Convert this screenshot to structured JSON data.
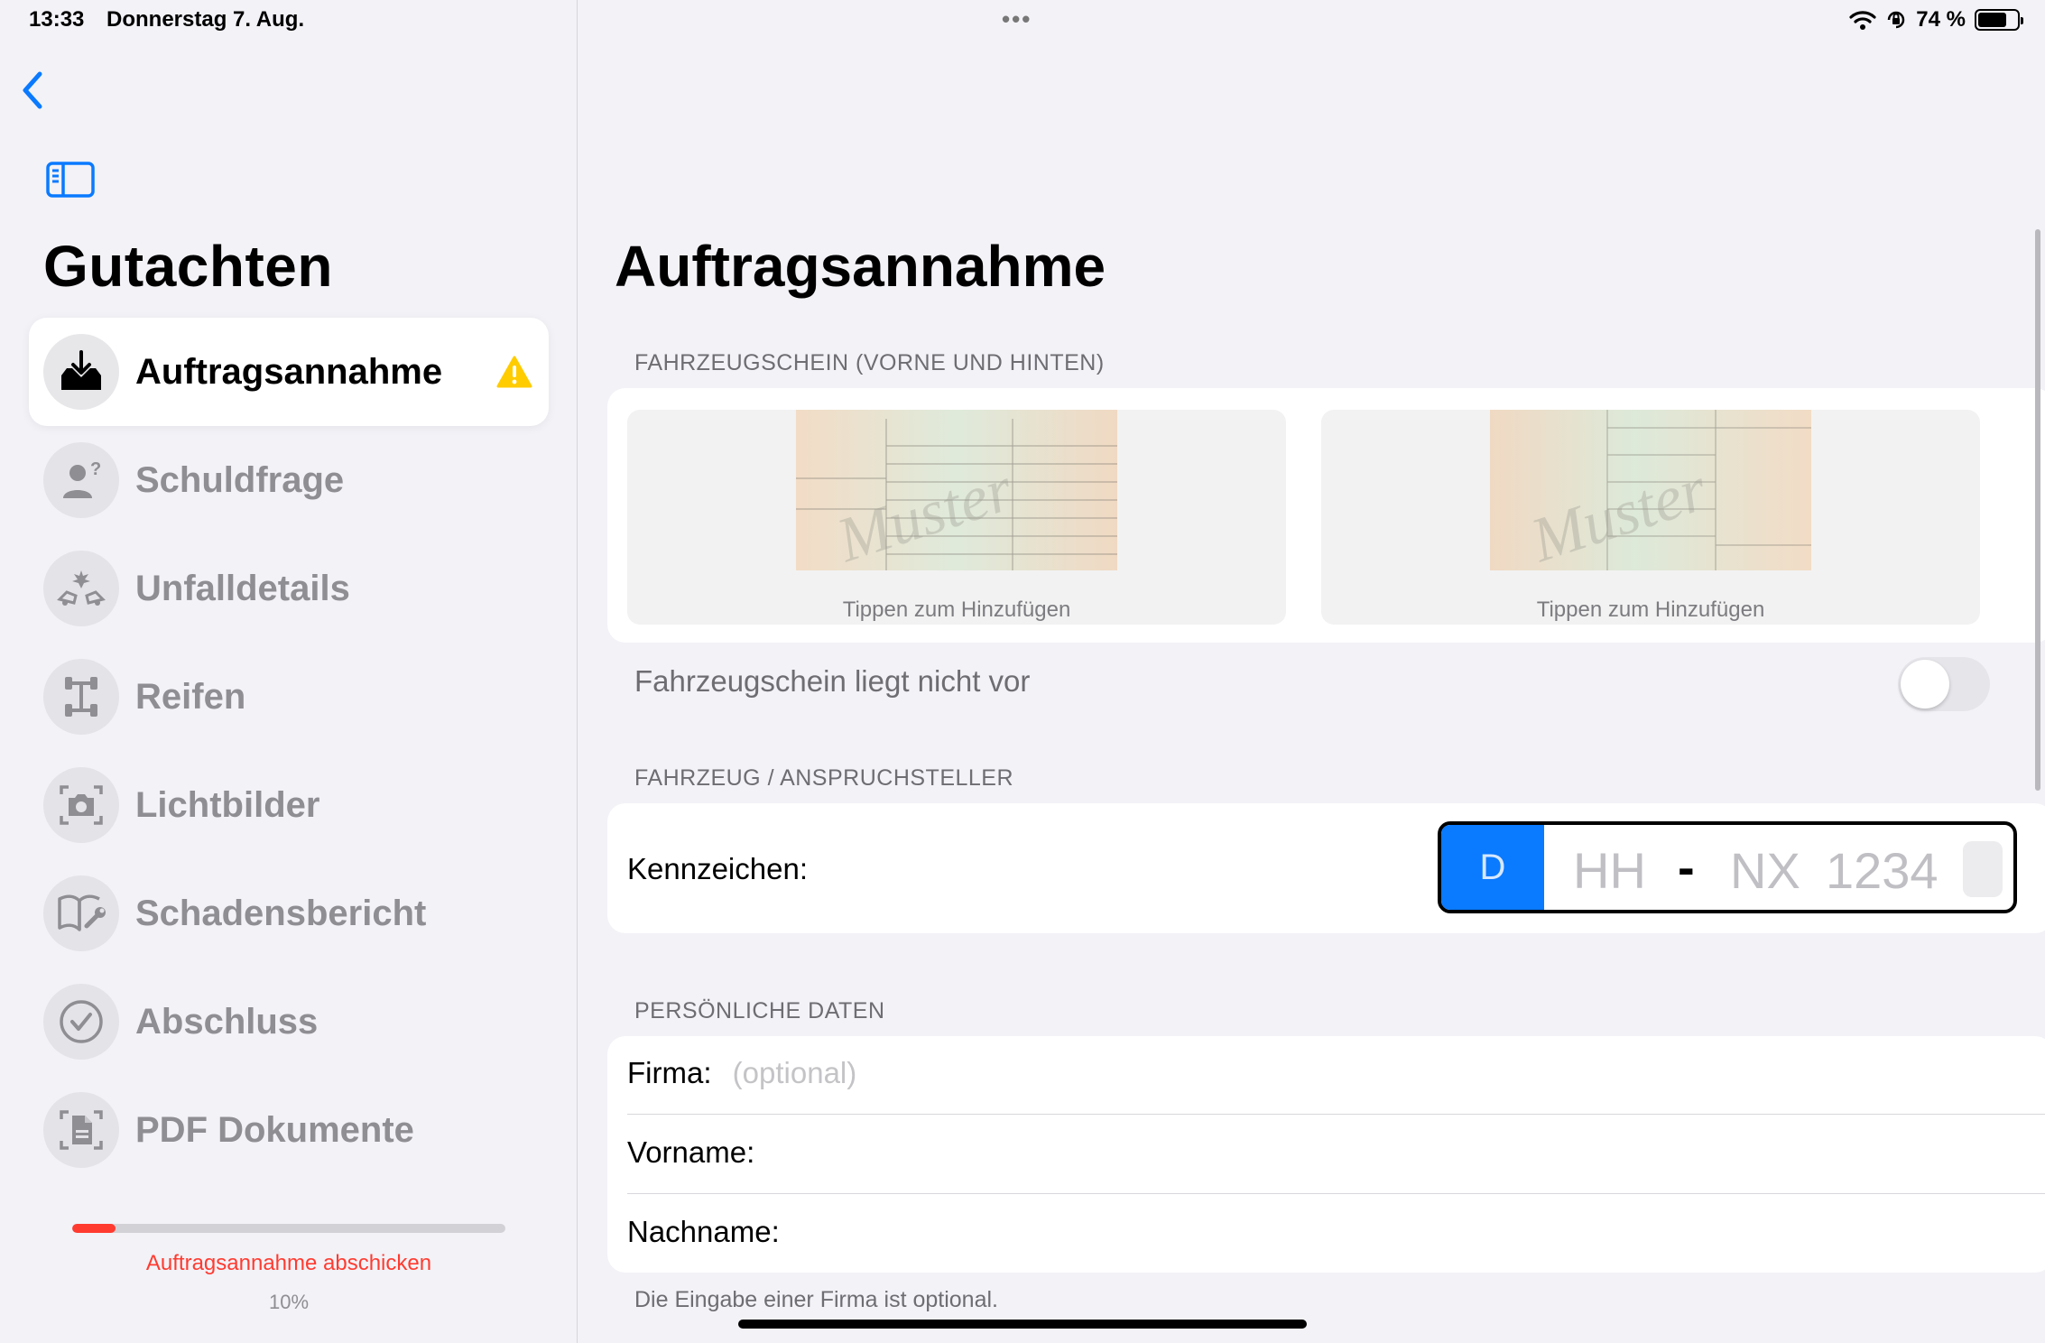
{
  "status_bar": {
    "time": "13:33",
    "date": "Donnerstag 7. Aug.",
    "battery_text": "74 %",
    "battery_level": 0.74
  },
  "sidebar": {
    "title": "Gutachten",
    "items": [
      {
        "label": "Auftragsannahme",
        "icon": "inbox-download-icon",
        "active": true
      },
      {
        "label": "Schuldfrage",
        "icon": "person-question-icon"
      },
      {
        "label": "Unfalldetails",
        "icon": "car-crash-icon"
      },
      {
        "label": "Reifen",
        "icon": "axle-icon"
      },
      {
        "label": "Lichtbilder",
        "icon": "camera-icon"
      },
      {
        "label": "Schadensbericht",
        "icon": "book-wrench-icon"
      },
      {
        "label": "Abschluss",
        "icon": "checkmark-circle-icon"
      },
      {
        "label": "PDF Dokumente",
        "icon": "document-icon"
      }
    ],
    "progress": {
      "value": 0.1,
      "submit_label": "Auftragsannahme abschicken",
      "percent_label": "10%"
    }
  },
  "main": {
    "title": "Auftragsannahme",
    "section_registration": "FAHRZEUGSCHEIN (VORNE UND HINTEN)",
    "doc_front_hint": "Tippen zum Hinzufügen",
    "doc_back_hint": "Tippen zum Hinzufügen",
    "toggle_label": "Fahrzeugschein liegt nicht vor",
    "toggle_on": false,
    "section_vehicle": "FAHRZEUG / ANSPRUCHSTELLER",
    "plate_label": "Kennzeichen:",
    "plate": {
      "country": "D",
      "city_placeholder": "HH",
      "dash": "-",
      "letters_placeholder": "NX",
      "numbers_placeholder": "1234"
    },
    "section_personal": "PERSÖNLICHE DATEN",
    "firma_label": "Firma:",
    "firma_placeholder": "(optional)",
    "vorname_label": "Vorname:",
    "nachname_label": "Nachname:",
    "footer_note": "Die Eingabe einer Firma ist optional."
  },
  "colors": {
    "accent": "#0a7aff",
    "warning": "#ffcc00",
    "error": "#ff3b30"
  }
}
